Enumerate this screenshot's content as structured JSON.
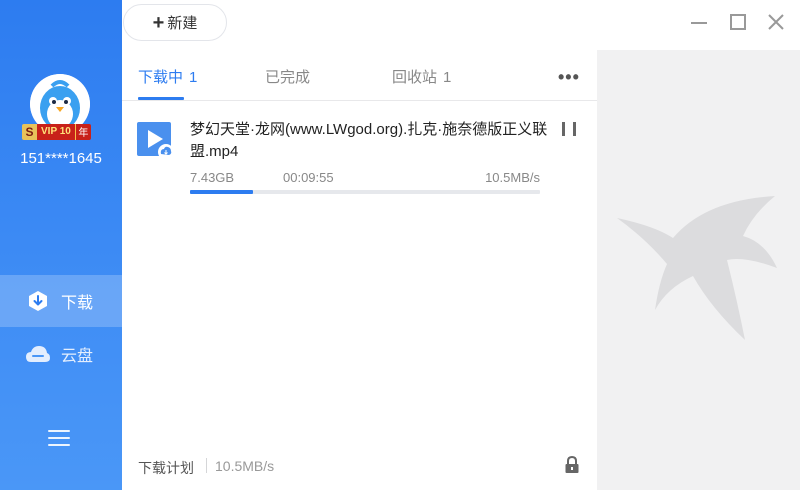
{
  "sidebar": {
    "vip": {
      "s": "S",
      "label": "VIP 10",
      "year": "年"
    },
    "username": "151****1645",
    "nav": [
      {
        "label": "下载",
        "icon": "download-icon",
        "active": true
      },
      {
        "label": "云盘",
        "icon": "cloud-icon",
        "active": false
      }
    ],
    "menu_icon": "hamburger-menu-icon"
  },
  "topbar": {
    "new_label": "新建",
    "controls": [
      "minimize-icon",
      "maximize-icon",
      "close-icon"
    ]
  },
  "tabs": [
    {
      "label": "下载中",
      "count": "1",
      "active": true
    },
    {
      "label": "已完成",
      "count": "",
      "active": false
    },
    {
      "label": "回收站",
      "count": "1",
      "active": false
    }
  ],
  "downloads": [
    {
      "name": "梦幻天堂·龙网(www.LWgod.org).扎克·施奈德版正义联盟.mp4",
      "size": "7.43GB",
      "time_left": "00:09:55",
      "speed": "10.5MB/s",
      "progress": 0.18
    }
  ],
  "footer": {
    "plan_label": "下载计划",
    "speed": "10.5MB/s"
  },
  "colors": {
    "accent": "#2d7cf0",
    "sidebar": "#3a87f3",
    "right_panel": "#f1f1f2"
  }
}
